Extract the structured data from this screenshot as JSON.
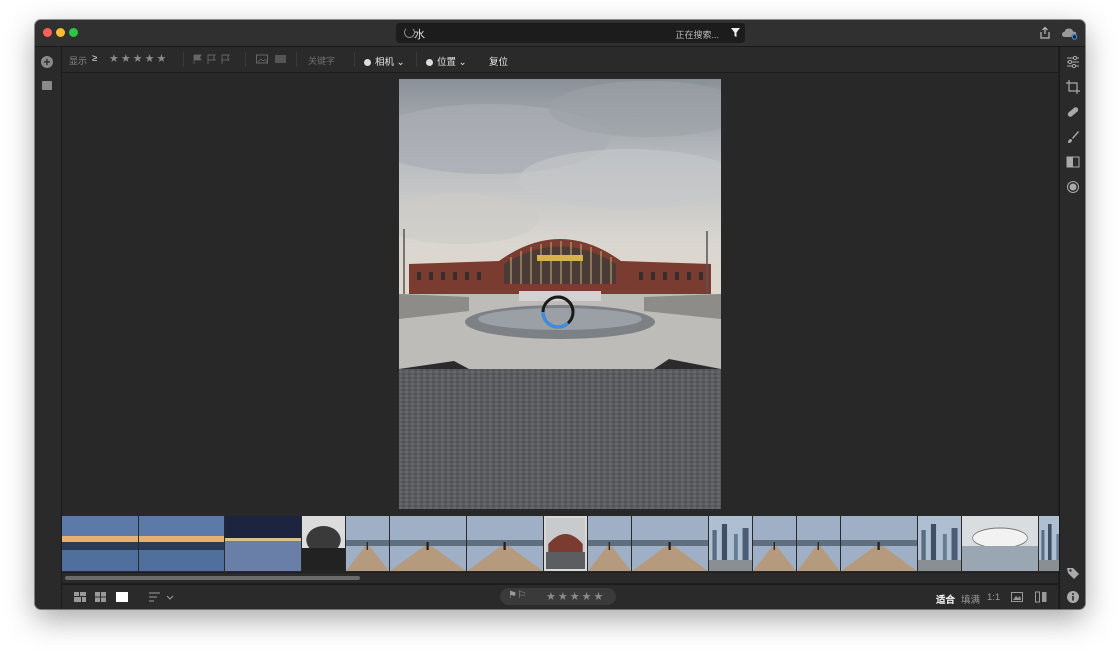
{
  "search": {
    "query": "水",
    "status": "正在搜索..."
  },
  "filterbar": {
    "show_label": "显示",
    "rating_op": "≥",
    "rating_stars": "★★★★★",
    "keyword_placeholder": "关键字",
    "camera_label": "相机",
    "location_label": "位置",
    "reset_label": "复位"
  },
  "bottombar": {
    "rating_stars": "★★★★★",
    "zoom_fit": "适合",
    "zoom_fill": "填满",
    "zoom_1to1": "1:1"
  },
  "filmstrip": {
    "thumbnails": [
      {
        "kind": "sunset-lake"
      },
      {
        "kind": "sunset-lake"
      },
      {
        "kind": "night-bridge"
      },
      {
        "kind": "station-dark"
      },
      {
        "kind": "boardwalk"
      },
      {
        "kind": "boardwalk"
      },
      {
        "kind": "boardwalk"
      },
      {
        "kind": "station-selected",
        "selected": true
      },
      {
        "kind": "boardwalk"
      },
      {
        "kind": "boardwalk"
      },
      {
        "kind": "city"
      },
      {
        "kind": "boardwalk"
      },
      {
        "kind": "boardwalk"
      },
      {
        "kind": "boardwalk"
      },
      {
        "kind": "city"
      },
      {
        "kind": "station-water"
      },
      {
        "kind": "city"
      }
    ]
  },
  "colors": {
    "accent": "#2d6fd6",
    "panel": "#2a2a2a",
    "canvas": "#282828"
  }
}
